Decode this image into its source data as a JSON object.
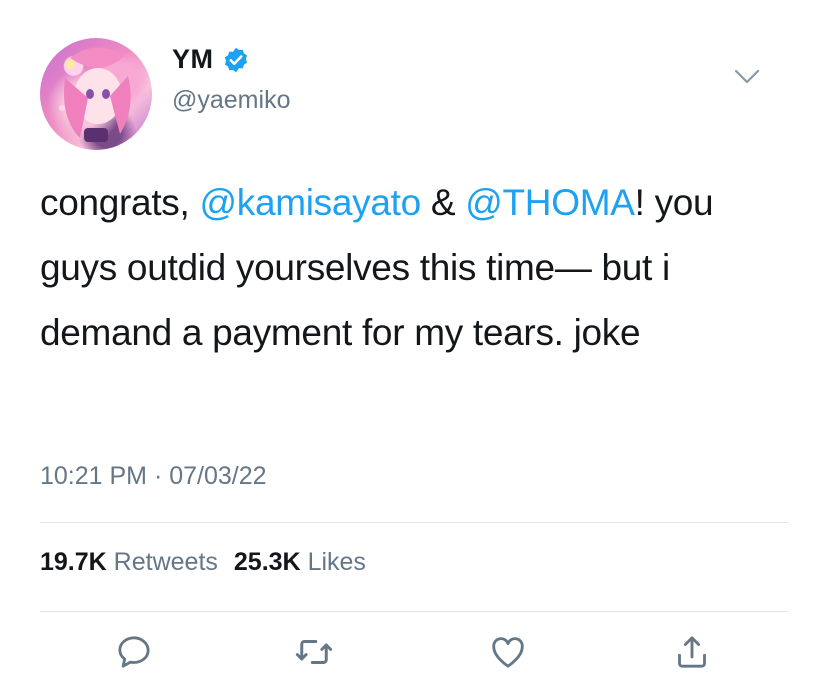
{
  "author": {
    "display_name": "YM",
    "handle": "@yaemiko",
    "verified_icon": "verified-badge-icon"
  },
  "tweet": {
    "text_part1": "congrats, ",
    "mention1": "@kamisayato",
    "text_part2": " & ",
    "mention2": "@THOMA",
    "text_part3": "! you guys outdid yourselves this time— but i demand a payment for my tears. joke",
    "time": "10:21 PM",
    "separator": "·",
    "date": "07/03/22"
  },
  "stats": {
    "retweets_count": "19.7K",
    "retweets_label": "Retweets",
    "likes_count": "25.3K",
    "likes_label": "Likes"
  },
  "actions": {
    "reply_icon": "reply-icon",
    "retweet_icon": "retweet-icon",
    "like_icon": "heart-icon",
    "share_icon": "share-icon"
  },
  "colors": {
    "mention": "#1da1f2",
    "secondary_text": "#657786",
    "divider": "#e1e8ed",
    "verified": "#1da1f2"
  }
}
